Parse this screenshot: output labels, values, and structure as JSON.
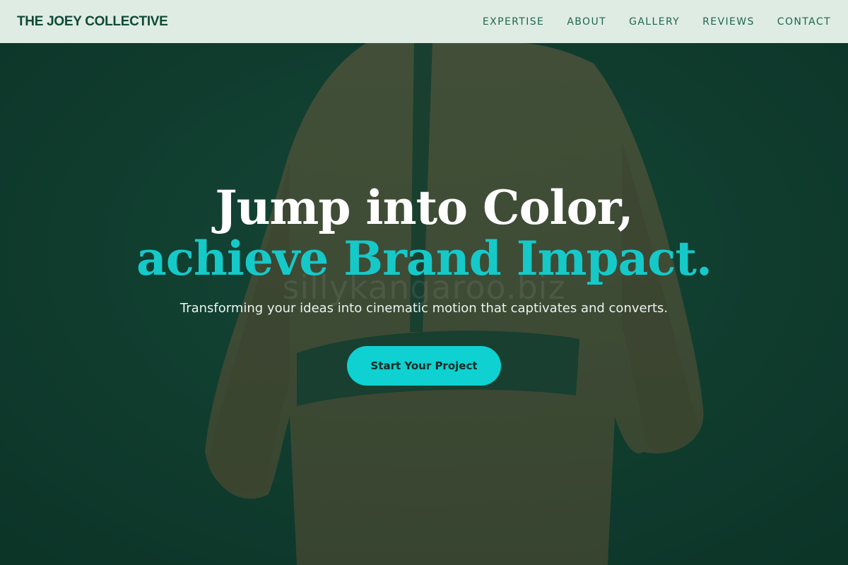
{
  "header": {
    "brand": "THE JOEY COLLECTIVE",
    "nav": [
      "EXPERTISE",
      "ABOUT",
      "GALLERY",
      "REVIEWS",
      "CONTACT"
    ]
  },
  "hero": {
    "headline_line1": "Jump into Color,",
    "headline_line2": "achieve Brand Impact.",
    "subheadline": "Transforming your ideas into cinematic motion that captivates and converts.",
    "cta_label": "Start Your Project",
    "watermark": "sillykangaroo.biz"
  },
  "colors": {
    "overlay": "#0e3a2d",
    "accent": "#16c9c9",
    "button": "#0fd1d1",
    "nav_text": "#1e6650",
    "brand_text": "#0f4a36"
  }
}
